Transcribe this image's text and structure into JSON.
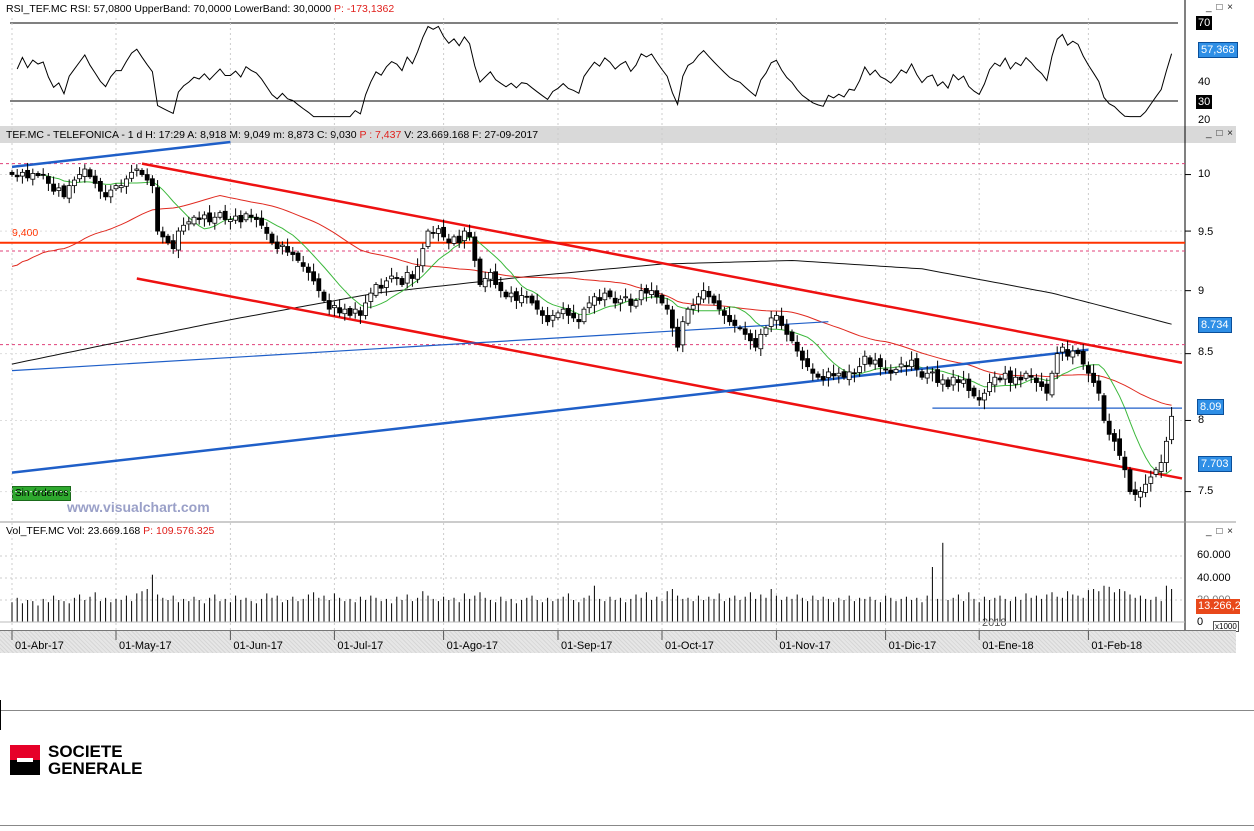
{
  "rsi_panel": {
    "header_prefix": "RSI_TEF.MC RSI: 57,0800 UpperBand: 70,0000 LowerBand: 30,0000",
    "header_p": "P: -173,1362",
    "ticks": [
      "70",
      "40",
      "30",
      "20"
    ],
    "current_label": "57,368",
    "upper_band": 70,
    "lower_band": 30
  },
  "price_panel": {
    "header_prefix": "TEF.MC - TELEFONICA - 1 d H: 17:29 A: 8,918 M: 9,049 m: 8,873 C: 9,030",
    "header_p": "P : 7,437",
    "header_suffix": "V: 23.669.168 F: 27-09-2017",
    "ticks": [
      "10",
      "9.5",
      "9",
      "8.5",
      "8",
      "7.5"
    ],
    "tags": [
      "8.734",
      "8.09",
      "7.703"
    ],
    "level_label": "9,400",
    "orders_badge": "Sin órdenes",
    "watermark": "www.visualchart.com"
  },
  "volume_panel": {
    "header_prefix": "Vol_TEF.MC Vol: 23.669.168",
    "header_p": "P: 109.576.325",
    "ticks": [
      "60.000",
      "40.000",
      "20.000",
      "0"
    ],
    "current_label": "13.266,2",
    "unit": "x1000"
  },
  "x_axis": {
    "dates": [
      "01-Abr-17",
      "01-May-17",
      "01-Jun-17",
      "01-Jul-17",
      "01-Ago-17",
      "01-Sep-17",
      "01-Oct-17",
      "01-Nov-17",
      "01-Dic-17",
      "01-Ene-18",
      "01-Feb-18"
    ],
    "date_bars": [
      0,
      20,
      42,
      62,
      83,
      105,
      125,
      147,
      168,
      186,
      207
    ],
    "year_label": "2018"
  },
  "window_buttons": "_ □ ×",
  "brand": {
    "line1": "SOCIETE",
    "line2": "GENERALE"
  },
  "colors": {
    "up_body": "#ffffff",
    "down_body": "#000000",
    "ma_fast": "#3cb83c",
    "ma_mid": "#e02a20",
    "ma_long": "#111111",
    "channel": "#ee1111",
    "trend_blue": "#1f5fc8",
    "level": "#ff3300",
    "dotted": "#e0407a"
  },
  "chart_data": {
    "type": "candlestick",
    "title": "TEF.MC - TELEFONICA - 1 d",
    "scale": "log",
    "ylim": [
      7.25,
      10.3
    ],
    "closes": [
      10.0,
      9.98,
      10.02,
      9.97,
      10.01,
      9.99,
      10.0,
      9.92,
      9.85,
      9.88,
      9.8,
      9.9,
      9.95,
      10.0,
      10.05,
      9.98,
      9.92,
      9.85,
      9.8,
      9.86,
      9.9,
      9.9,
      9.96,
      10.02,
      10.05,
      10.0,
      9.95,
      9.9,
      9.5,
      9.45,
      9.4,
      9.35,
      9.5,
      9.55,
      9.58,
      9.62,
      9.6,
      9.64,
      9.58,
      9.62,
      9.66,
      9.6,
      9.6,
      9.63,
      9.58,
      9.65,
      9.62,
      9.6,
      9.55,
      9.48,
      9.4,
      9.35,
      9.38,
      9.32,
      9.3,
      9.25,
      9.2,
      9.15,
      9.08,
      9.0,
      8.92,
      8.85,
      8.88,
      8.82,
      8.85,
      8.8,
      8.85,
      8.8,
      8.9,
      8.98,
      9.05,
      9.02,
      9.08,
      9.12,
      9.1,
      9.05,
      9.15,
      9.1,
      9.2,
      9.35,
      9.5,
      9.48,
      9.52,
      9.45,
      9.4,
      9.45,
      9.4,
      9.5,
      9.45,
      9.25,
      9.05,
      9.1,
      9.15,
      9.05,
      9.0,
      8.95,
      8.98,
      8.92,
      8.96,
      8.95,
      8.9,
      8.85,
      8.8,
      8.75,
      8.8,
      8.82,
      8.85,
      8.8,
      8.78,
      8.75,
      8.85,
      8.9,
      8.95,
      8.92,
      8.98,
      8.95,
      8.9,
      8.93,
      8.95,
      8.88,
      8.92,
      9.0,
      8.98,
      9.0,
      8.95,
      8.9,
      8.85,
      8.7,
      8.55,
      8.75,
      8.85,
      8.88,
      8.95,
      9.0,
      8.95,
      8.9,
      8.85,
      8.8,
      8.75,
      8.72,
      8.7,
      8.65,
      8.6,
      8.55,
      8.65,
      8.7,
      8.78,
      8.8,
      8.72,
      8.65,
      8.6,
      8.52,
      8.45,
      8.4,
      8.35,
      8.32,
      8.3,
      8.36,
      8.33,
      8.35,
      8.32,
      8.36,
      8.35,
      8.4,
      8.48,
      8.42,
      8.45,
      8.4,
      8.38,
      8.35,
      8.38,
      8.42,
      8.4,
      8.45,
      8.38,
      8.32,
      8.35,
      8.36,
      8.28,
      8.3,
      8.25,
      8.32,
      8.28,
      8.3,
      8.22,
      8.18,
      8.15,
      8.2,
      8.28,
      8.32,
      8.3,
      8.35,
      8.28,
      8.32,
      8.3,
      8.35,
      8.32,
      8.28,
      8.25,
      8.2,
      8.35,
      8.5,
      8.55,
      8.48,
      8.52,
      8.5,
      8.42,
      8.35,
      8.28,
      8.2,
      8.0,
      7.9,
      7.85,
      7.75,
      7.65,
      7.5,
      7.48,
      7.5,
      7.55,
      7.6,
      7.65,
      7.7,
      7.85,
      8.03
    ],
    "volumes_k": [
      18,
      22,
      17,
      20,
      19,
      15,
      21,
      18,
      24,
      20,
      19,
      17,
      22,
      25,
      20,
      23,
      27,
      19,
      22,
      18,
      21,
      20,
      24,
      19,
      26,
      28,
      30,
      43,
      25,
      22,
      20,
      24,
      18,
      21,
      19,
      23,
      20,
      17,
      22,
      25,
      19,
      21,
      18,
      24,
      20,
      22,
      19,
      17,
      21,
      26,
      22,
      24,
      18,
      20,
      23,
      19,
      21,
      25,
      27,
      22,
      24,
      20,
      26,
      22,
      19,
      21,
      18,
      23,
      20,
      24,
      22,
      19,
      21,
      17,
      23,
      20,
      25,
      19,
      22,
      28,
      24,
      21,
      19,
      23,
      20,
      22,
      18,
      26,
      21,
      24,
      27,
      22,
      20,
      18,
      23,
      19,
      21,
      17,
      20,
      22,
      24,
      20,
      18,
      22,
      19,
      21,
      23,
      26,
      20,
      18,
      22,
      24,
      33,
      21,
      19,
      23,
      20,
      22,
      18,
      21,
      25,
      22,
      27,
      20,
      23,
      19,
      28,
      30,
      24,
      21,
      22,
      19,
      24,
      20,
      23,
      21,
      26,
      19,
      22,
      24,
      20,
      23,
      27,
      21,
      25,
      22,
      30,
      24,
      20,
      23,
      21,
      25,
      22,
      19,
      24,
      20,
      23,
      21,
      18,
      22,
      20,
      24,
      19,
      22,
      21,
      23,
      20,
      18,
      24,
      22,
      19,
      21,
      23,
      20,
      22,
      18,
      24,
      50,
      21,
      72,
      20,
      22,
      25,
      19,
      27,
      21,
      18,
      23,
      20,
      22,
      24,
      21,
      19,
      23,
      20,
      26,
      22,
      24,
      21,
      25,
      27,
      23,
      22,
      28,
      25,
      24,
      22,
      29,
      30,
      28,
      33,
      32,
      27,
      30,
      28,
      25,
      22,
      24,
      21,
      20,
      23,
      19,
      33,
      30
    ],
    "ma_fast_period": 10,
    "ma_mid_period": 40,
    "ma_long_points": [
      [
        0,
        8.42
      ],
      [
        40,
        8.75
      ],
      [
        70,
        8.98
      ],
      [
        100,
        9.12
      ],
      [
        125,
        9.22
      ],
      [
        150,
        9.25
      ],
      [
        175,
        9.18
      ],
      [
        200,
        8.98
      ],
      [
        223,
        8.73
      ]
    ],
    "trendlines": [
      {
        "name": "channel-upper",
        "color": "channel",
        "from": [
          25,
          10.1
        ],
        "to": [
          225,
          8.43
        ]
      },
      {
        "name": "channel-lower",
        "color": "channel",
        "from": [
          24,
          9.1
        ],
        "to": [
          225,
          7.59
        ]
      },
      {
        "name": "blue-top",
        "color": "trend_blue",
        "from": [
          0,
          10.07
        ],
        "to": [
          42,
          10.3
        ]
      },
      {
        "name": "blue-support",
        "color": "trend_blue",
        "from": [
          0,
          7.63
        ],
        "to": [
          207,
          8.53
        ]
      },
      {
        "name": "blue-mid",
        "color": "trend_blue",
        "from": [
          0,
          8.37
        ],
        "to": [
          157,
          8.75
        ],
        "thin": true
      },
      {
        "name": "blue-horizontal",
        "color": "trend_blue",
        "from": [
          177,
          8.09
        ],
        "to": [
          225,
          8.09
        ],
        "thin": true
      }
    ],
    "level": 9.4,
    "dotted_levels": [
      10.1,
      9.33,
      8.57
    ],
    "rsi_period": 14
  }
}
